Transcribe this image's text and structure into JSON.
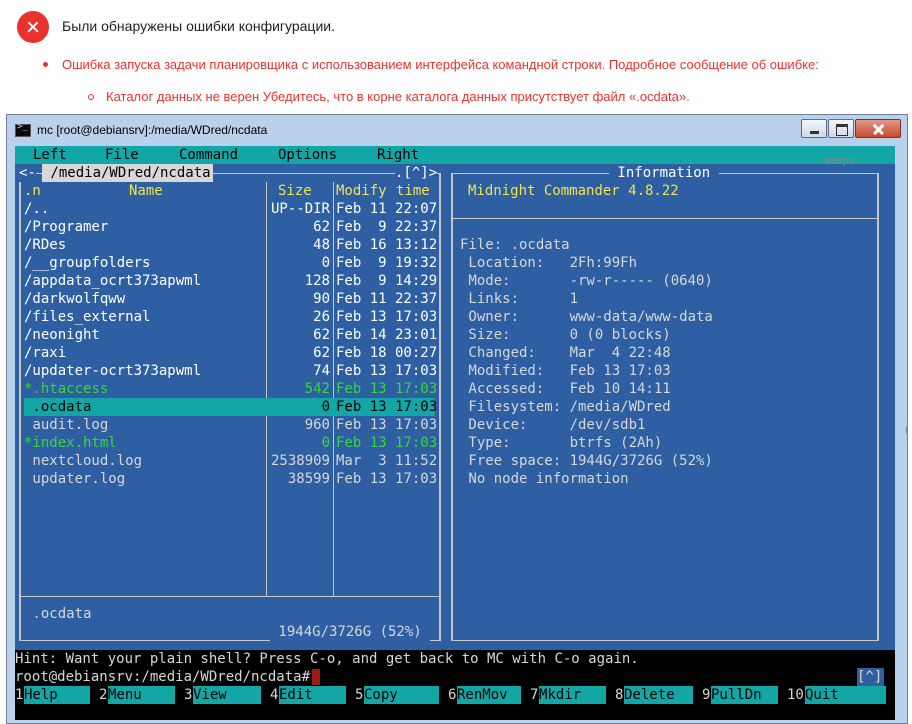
{
  "errors": {
    "title": "Были обнаружены ошибки конфигурации.",
    "item": "Ошибка запуска задачи планировщика с использованием интерфейса командной строки. Подробное сообщение об ошибке:",
    "subitem": "Каталог данных не верен Убедитесь, что в корне каталога данных присутствует файл «.ocdata».",
    "side_text": "вверх",
    "side_text2": "t",
    "icon": "error-x-icon",
    "color": "#e9322d"
  },
  "window": {
    "title": "mc [root@debiansrv]:/media/WDred/ncdata"
  },
  "menu": [
    "Left",
    "File",
    "Command",
    "Options",
    "Right"
  ],
  "left_panel": {
    "path": " /media/WDred/ncdata ",
    "corner_left": "<-",
    "corner_right": ".[^]>",
    "col_n": ".n",
    "col_name": "Name",
    "col_size": "Size",
    "col_modify": "Modify",
    "col_time": "time",
    "files": [
      {
        "name": "/..",
        "size": "UP--DIR",
        "date": "Feb 11 22:07",
        "color": "white"
      },
      {
        "name": "/Programer",
        "size": "62",
        "date": "Feb  9 22:37",
        "color": "white"
      },
      {
        "name": "/RDes",
        "size": "48",
        "date": "Feb 16 13:12",
        "color": "white"
      },
      {
        "name": "/__groupfolders",
        "size": "0",
        "date": "Feb  9 19:32",
        "color": "white"
      },
      {
        "name": "/appdata_ocrt373apwml",
        "size": "128",
        "date": "Feb  9 14:29",
        "color": "white"
      },
      {
        "name": "/darkwolfqww",
        "size": "90",
        "date": "Feb 11 22:37",
        "color": "white"
      },
      {
        "name": "/files_external",
        "size": "26",
        "date": "Feb 13 17:03",
        "color": "white"
      },
      {
        "name": "/neonight",
        "size": "62",
        "date": "Feb 14 23:01",
        "color": "white"
      },
      {
        "name": "/raxi",
        "size": "62",
        "date": "Feb 18 00:27",
        "color": "white"
      },
      {
        "name": "/updater-ocrt373apwml",
        "size": "74",
        "date": "Feb 13 17:03",
        "color": "white"
      },
      {
        "name": "*.htaccess",
        "size": "542",
        "date": "Feb 13 17:03",
        "color": "green"
      },
      {
        "name": " .ocdata",
        "size": "0",
        "date": "Feb 13 17:03",
        "color": "selected"
      },
      {
        "name": " audit.log",
        "size": "960",
        "date": "Feb 13 17:03",
        "color": "gray"
      },
      {
        "name": "*index.html",
        "size": "0",
        "date": "Feb 13 17:03",
        "color": "green"
      },
      {
        "name": " nextcloud.log",
        "size": "2538909",
        "date": "Mar  3 11:52",
        "color": "gray"
      },
      {
        "name": " updater.log",
        "size": "38599",
        "date": "Feb 13 17:03",
        "color": "gray"
      }
    ],
    "mini_status": " .ocdata",
    "free": " 1944G/3726G (52%) "
  },
  "right_panel": {
    "title": " Information ",
    "app": "Midnight Commander 4.8.22",
    "lines": [
      "File: .ocdata",
      " Location:   2Fh:99Fh",
      " Mode:       -rw-r----- (0640)",
      " Links:      1",
      " Owner:      www-data/www-data",
      " Size:       0 (0 blocks)",
      " Changed:    Mar  4 22:48",
      " Modified:   Feb 13 17:03",
      " Accessed:   Feb 10 14:11",
      " Filesystem: /media/WDred",
      " Device:     /dev/sdb1",
      " Type:       btrfs (2Ah)",
      " Free space: 1944G/3726G (52%)",
      " No node information"
    ]
  },
  "hint": "Hint: Want your plain shell? Press C-o, and get back to MC with C-o again.",
  "prompt": "root@debiansrv:/media/WDred/ncdata#",
  "subshell_corner": "[^]",
  "fkeys": [
    {
      "num": "1",
      "label": "Help"
    },
    {
      "num": "2",
      "label": "Menu"
    },
    {
      "num": "3",
      "label": "View"
    },
    {
      "num": "4",
      "label": "Edit"
    },
    {
      "num": "5",
      "label": "Copy"
    },
    {
      "num": "6",
      "label": "RenMov"
    },
    {
      "num": "7",
      "label": "Mkdir"
    },
    {
      "num": "8",
      "label": "Delete"
    },
    {
      "num": "9",
      "label": "PullDn"
    },
    {
      "num": "10",
      "label": "Quit"
    }
  ],
  "colors": {
    "panel": "#2e5fa3",
    "menu": "#12a6a6",
    "executable": "#38d639",
    "header": "#f2e24f"
  }
}
